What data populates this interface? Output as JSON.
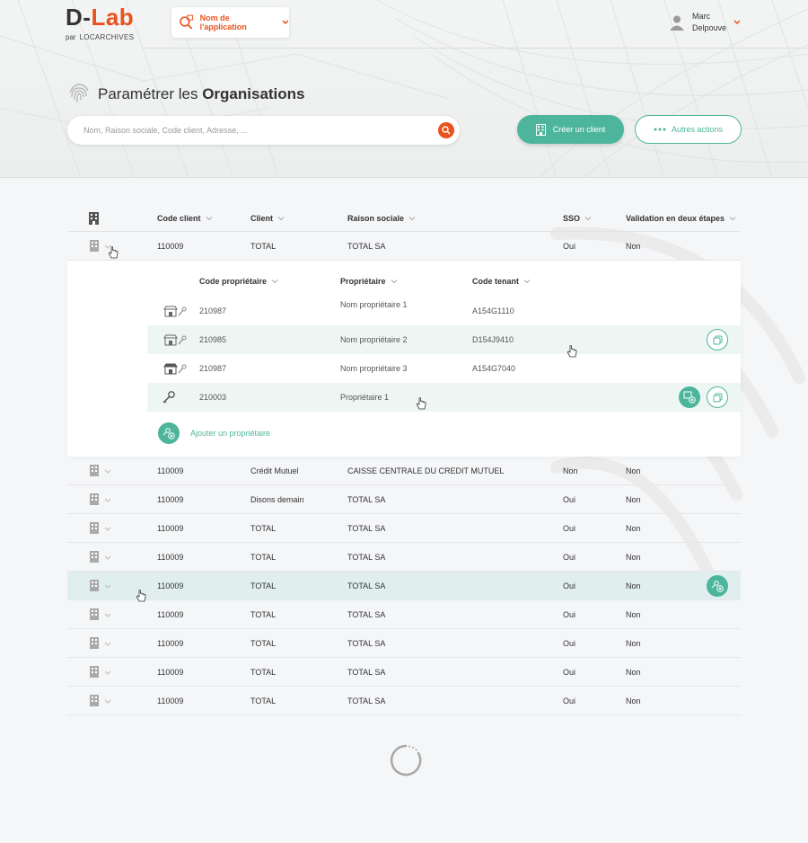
{
  "header": {
    "logo": {
      "d": "D-",
      "lab": "Lab",
      "par": "par",
      "brand": "LOCARCHIVES"
    },
    "app_selector_label": "Nom de l'application",
    "user": {
      "first": "Marc",
      "last": "Delpouve"
    }
  },
  "page": {
    "title_prefix": "Paramétrer les ",
    "title_bold": "Organisations",
    "search_placeholder": "Nom, Raison sociale, Code client, Adresse, ...",
    "create_button": "Créer un client",
    "other_actions_button": "Autres actions"
  },
  "table": {
    "headers": {
      "code_client": "Code client",
      "client": "Client",
      "raison_sociale": "Raison sociale",
      "sso": "SSO",
      "validation": "Validation en deux étapes"
    },
    "first_row": {
      "code": "110009",
      "client": "TOTAL",
      "raison": "TOTAL SA",
      "sso": "Oui",
      "validation": "Non"
    },
    "sub_headers": {
      "code_proprietaire": "Code propriétaire",
      "proprietaire": "Propriétaire",
      "code_tenant": "Code tenant"
    },
    "owners": [
      {
        "code": "210987",
        "name": "Nom propriétaire 1",
        "tenant": "A154G1110"
      },
      {
        "code": "210985",
        "name": "Nom propriétaire 2",
        "tenant": "D154J9410"
      },
      {
        "code": "210987",
        "name": "Nom propriétaire 3",
        "tenant": "A154G7040"
      },
      {
        "code": "210003",
        "name": "Propriétaire 1",
        "tenant": ""
      }
    ],
    "add_owner_label": "Ajouter un propriétaire",
    "rows": [
      {
        "code": "110009",
        "client": "Crédit Mutuel",
        "raison": "CAISSE CENTRALE DU CREDIT MUTUEL",
        "sso": "Non",
        "validation": "Non"
      },
      {
        "code": "110009",
        "client": "Disons demain",
        "raison": "TOTAL SA",
        "sso": "Oui",
        "validation": "Non"
      },
      {
        "code": "110009",
        "client": "TOTAL",
        "raison": "TOTAL SA",
        "sso": "Oui",
        "validation": "Non"
      },
      {
        "code": "110009",
        "client": "TOTAL",
        "raison": "TOTAL SA",
        "sso": "Oui",
        "validation": "Non"
      },
      {
        "code": "110009",
        "client": "TOTAL",
        "raison": "TOTAL SA",
        "sso": "Oui",
        "validation": "Non"
      },
      {
        "code": "110009",
        "client": "TOTAL",
        "raison": "TOTAL SA",
        "sso": "Oui",
        "validation": "Non"
      },
      {
        "code": "110009",
        "client": "TOTAL",
        "raison": "TOTAL SA",
        "sso": "Oui",
        "validation": "Non"
      },
      {
        "code": "110009",
        "client": "TOTAL",
        "raison": "TOTAL SA",
        "sso": "Oui",
        "validation": "Non"
      },
      {
        "code": "110009",
        "client": "TOTAL",
        "raison": "TOTAL SA",
        "sso": "Oui",
        "validation": "Non"
      }
    ]
  },
  "colors": {
    "accent": "#e8521c",
    "primary": "#4db59b",
    "highlight": "#e0efee"
  }
}
